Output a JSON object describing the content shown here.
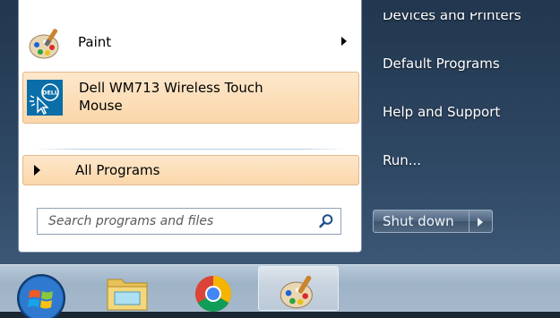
{
  "start_menu": {
    "programs": [
      {
        "label": "Paint",
        "icon": "paint-palette-icon",
        "has_submenu": true
      },
      {
        "label_line1": "Dell WM713 Wireless Touch",
        "label_line2": "Mouse",
        "icon": "dell-touch-mouse-icon",
        "highlighted": true
      }
    ],
    "all_programs_label": "All Programs",
    "search": {
      "placeholder": "Search programs and files",
      "value": ""
    },
    "right_panel": {
      "items": [
        "Devices and Printers",
        "Default Programs",
        "Help and Support",
        "Run..."
      ]
    },
    "shutdown": {
      "label": "Shut down"
    }
  },
  "taskbar": {
    "items": [
      "start-orb",
      "windows-explorer-icon",
      "google-chrome-icon",
      "paint-palette-icon"
    ]
  },
  "colors": {
    "highlight": "#fbd7aa",
    "highlight_border": "#e2b98a",
    "glass_panel": "#2e4763",
    "taskbar": "#a6b9cc"
  }
}
